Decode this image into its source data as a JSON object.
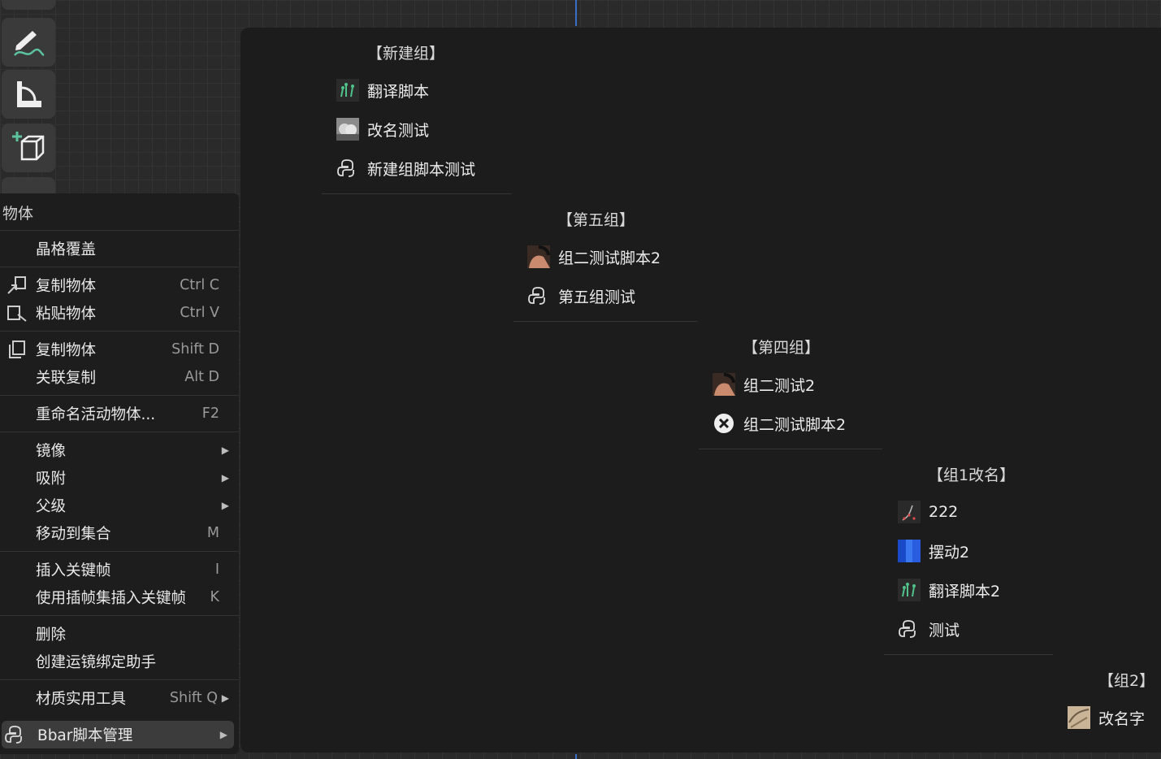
{
  "toolbar": {
    "tools": [
      {
        "name": "annotate-tool",
        "icon": "pencil-line-icon"
      },
      {
        "name": "measure-tool",
        "icon": "ruler-angle-icon"
      },
      {
        "name": "add-cube-tool",
        "icon": "add-cube-icon"
      }
    ]
  },
  "context_menu": {
    "title": "物体",
    "items": [
      {
        "label": "晶格覆盖",
        "shortcut": ""
      },
      {
        "label": "复制物体",
        "shortcut": "Ctrl C",
        "icon": "copy-to-buffer-icon"
      },
      {
        "label": "粘贴物体",
        "shortcut": "Ctrl V",
        "icon": "paste-from-buffer-icon"
      },
      {
        "label": "复制物体",
        "shortcut": "Shift D",
        "icon": "duplicate-icon"
      },
      {
        "label": "关联复制",
        "shortcut": "Alt D"
      },
      {
        "label": "重命名活动物体...",
        "shortcut": "F2"
      },
      {
        "label": "镜像",
        "shortcut": "",
        "submenu": true
      },
      {
        "label": "吸附",
        "shortcut": "",
        "submenu": true
      },
      {
        "label": "父级",
        "shortcut": "",
        "submenu": true
      },
      {
        "label": "移动到集合",
        "shortcut": "M"
      },
      {
        "label": "插入关键帧",
        "shortcut": "I"
      },
      {
        "label": "使用插帧集插入关键帧",
        "shortcut": "K"
      },
      {
        "label": "删除",
        "shortcut": ""
      },
      {
        "label": "创建运镜绑定助手",
        "shortcut": ""
      },
      {
        "label": "材质实用工具",
        "shortcut": "Shift Q",
        "submenu": true
      },
      {
        "label": "Bbar脚本管理",
        "shortcut": "",
        "submenu": true,
        "icon": "python-icon",
        "active": true
      }
    ]
  },
  "submenu": {
    "groups": [
      {
        "header": "【新建组】",
        "items": [
          {
            "label": "翻译脚本",
            "icon": "translate-sprout-icon"
          },
          {
            "label": "改名测试",
            "icon": "cloud-thumbnail-icon"
          },
          {
            "label": "新建组脚本测试",
            "icon": "python-icon"
          }
        ]
      },
      {
        "header": "【第五组】",
        "items": [
          {
            "label": "组二测试脚本2",
            "icon": "photo-thumbnail-icon"
          },
          {
            "label": "第五组测试",
            "icon": "python-icon"
          }
        ]
      },
      {
        "header": "【第四组】",
        "items": [
          {
            "label": "组二测试2",
            "icon": "photo-thumbnail-icon"
          },
          {
            "label": "组二测试脚本2",
            "icon": "x-circle-icon"
          }
        ]
      },
      {
        "header": "【组1改名】",
        "items": [
          {
            "label": "222",
            "icon": "curve-points-icon"
          },
          {
            "label": "摆动2",
            "icon": "blue-bars-icon"
          },
          {
            "label": "翻译脚本2",
            "icon": "translate-sprout-icon"
          },
          {
            "label": "测试",
            "icon": "python-icon"
          }
        ]
      },
      {
        "header": "【组2】",
        "items": [
          {
            "label": "改名字",
            "icon": "sketch-thumbnail-icon"
          }
        ]
      }
    ]
  },
  "colors": {
    "accent_blue": "#3a6fc7",
    "menu_bg": "#1d1d1d",
    "active_bg": "#3c3c3c"
  }
}
